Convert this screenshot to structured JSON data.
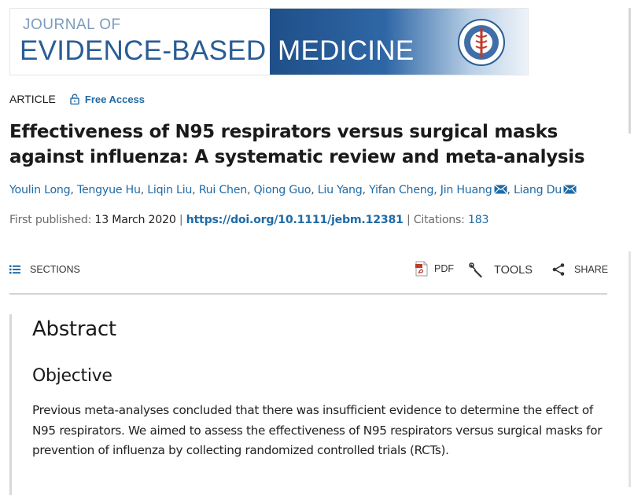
{
  "journal": {
    "line_small": "JOURNAL OF",
    "line_big_left": "EVIDENCE-BASED",
    "line_big_right": "MEDICINE"
  },
  "article": {
    "type": "ARTICLE",
    "access_label": "Free Access",
    "title": "Effectiveness of N95 respirators versus surgical masks against influenza: A systematic review and meta-analysis"
  },
  "authors": [
    {
      "name": "Youlin Long",
      "email": false
    },
    {
      "name": "Tengyue Hu",
      "email": false
    },
    {
      "name": "Liqin Liu",
      "email": false
    },
    {
      "name": "Rui Chen",
      "email": false
    },
    {
      "name": "Qiong Guo",
      "email": false
    },
    {
      "name": "Liu Yang",
      "email": false
    },
    {
      "name": "Yifan Cheng",
      "email": false
    },
    {
      "name": "Jin Huang",
      "email": true
    },
    {
      "name": "Liang Du",
      "email": true
    }
  ],
  "publication": {
    "first_published_label": "First published:",
    "first_published_date": "13 March 2020",
    "doi": "https://doi.org/10.1111/jebm.12381",
    "citations_label": "Citations:",
    "citations_count": "183"
  },
  "toolbar": {
    "sections_label": "SECTIONS",
    "pdf_label": "PDF",
    "tools_label": "TOOLS",
    "share_label": "SHARE"
  },
  "abstract": {
    "heading": "Abstract",
    "objective_heading": "Objective",
    "objective_text": "Previous meta-analyses concluded that there was insufficient evidence to determine the effect of N95 respirators. We aimed to assess the effectiveness of N95 respirators versus surgical masks for prevention of influenza by collecting randomized controlled trials (RCTs)."
  },
  "colors": {
    "link": "#1f6aa5",
    "brand_blue": "#2a5d94"
  }
}
